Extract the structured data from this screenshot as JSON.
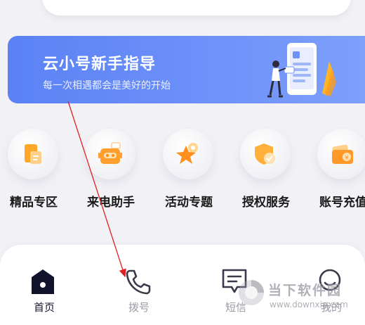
{
  "banner": {
    "title": "云小号新手指导",
    "subtitle": "每一次相遇都会是美好的开始"
  },
  "services": [
    {
      "label": "精品专区",
      "icon": "document-icon",
      "color": "#ffa726"
    },
    {
      "label": "来电助手",
      "icon": "robot-icon",
      "color": "#ff9f2e"
    },
    {
      "label": "活动专题",
      "icon": "star-icon",
      "color": "#ff8f1f"
    },
    {
      "label": "授权服务",
      "icon": "shield-check-icon",
      "color": "#ffb03a"
    },
    {
      "label": "账号充值",
      "icon": "wallet-icon",
      "color": "#ff9a2a"
    }
  ],
  "tabbar": {
    "items": [
      {
        "label": "首页",
        "icon": "home-icon",
        "active": true
      },
      {
        "label": "拨号",
        "icon": "phone-icon",
        "active": false
      },
      {
        "label": "短信",
        "icon": "message-icon",
        "active": false
      },
      {
        "label": "我的",
        "icon": "profile-icon",
        "active": false
      }
    ]
  },
  "watermark": {
    "name": "当下软件园",
    "url": "www.downxia.com"
  },
  "colors": {
    "banner": "#6a8ff8",
    "accent_orange": "#ff9f2e",
    "annotation_arrow": "#e02020"
  }
}
